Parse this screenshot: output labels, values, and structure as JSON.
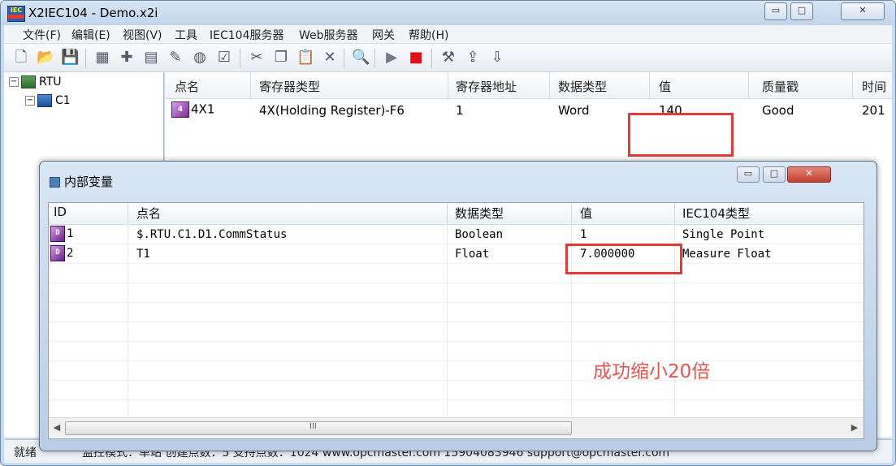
{
  "window": {
    "title": "X2IEC104 - Demo.x2i",
    "icon_text": "IEC"
  },
  "menu": [
    "文件(F)",
    "编辑(E)",
    "视图(V)",
    "工具",
    "IEC104服务器",
    "Web服务器",
    "网关",
    "帮助(H)"
  ],
  "toolbar_icons": [
    "new-file-icon",
    "open-folder-icon",
    "save-icon",
    "add-channel-icon",
    "add-device-icon",
    "add-point-icon",
    "add-group-icon",
    "add-tag-icon",
    "properties-icon",
    "cut-icon",
    "copy-icon",
    "paste-icon",
    "delete-icon",
    "find-icon",
    "run-icon",
    "stop-icon",
    "tools-icon",
    "load-icon",
    "download-icon"
  ],
  "tree": {
    "root": "RTU",
    "child": "C1"
  },
  "grid": {
    "headers": [
      "点名",
      "寄存器类型",
      "寄存器地址",
      "数据类型",
      "值",
      "质量戳",
      "时间"
    ],
    "row": {
      "name": "4X1",
      "register_type": "4X(Holding Register)-F6",
      "address": "1",
      "data_type": "Word",
      "value": "140",
      "quality": "Good",
      "time": "201"
    }
  },
  "child_window": {
    "title": "内部变量",
    "headers": [
      "ID",
      "点名",
      "数据类型",
      "值",
      "IEC104类型"
    ],
    "rows": [
      {
        "id": "1",
        "name": "$.RTU.C1.D1.CommStatus",
        "data_type": "Boolean",
        "value": "1",
        "iec_type": "Single Point"
      },
      {
        "id": "2",
        "name": "T1",
        "data_type": "Float",
        "value": "7.000000",
        "iec_type": "Measure Float"
      }
    ],
    "annotation": "成功缩小20倍",
    "scroll_grip": "III"
  },
  "statusbar": {
    "ready": "就绪",
    "text": "监控模式：单站  创建点数：5  支持点数：1024  www.opcmaster.com  15904083946  support@opcmaster.com"
  },
  "colors": {
    "highlight_box": "#e33a37",
    "annotation": "#e8534f"
  }
}
